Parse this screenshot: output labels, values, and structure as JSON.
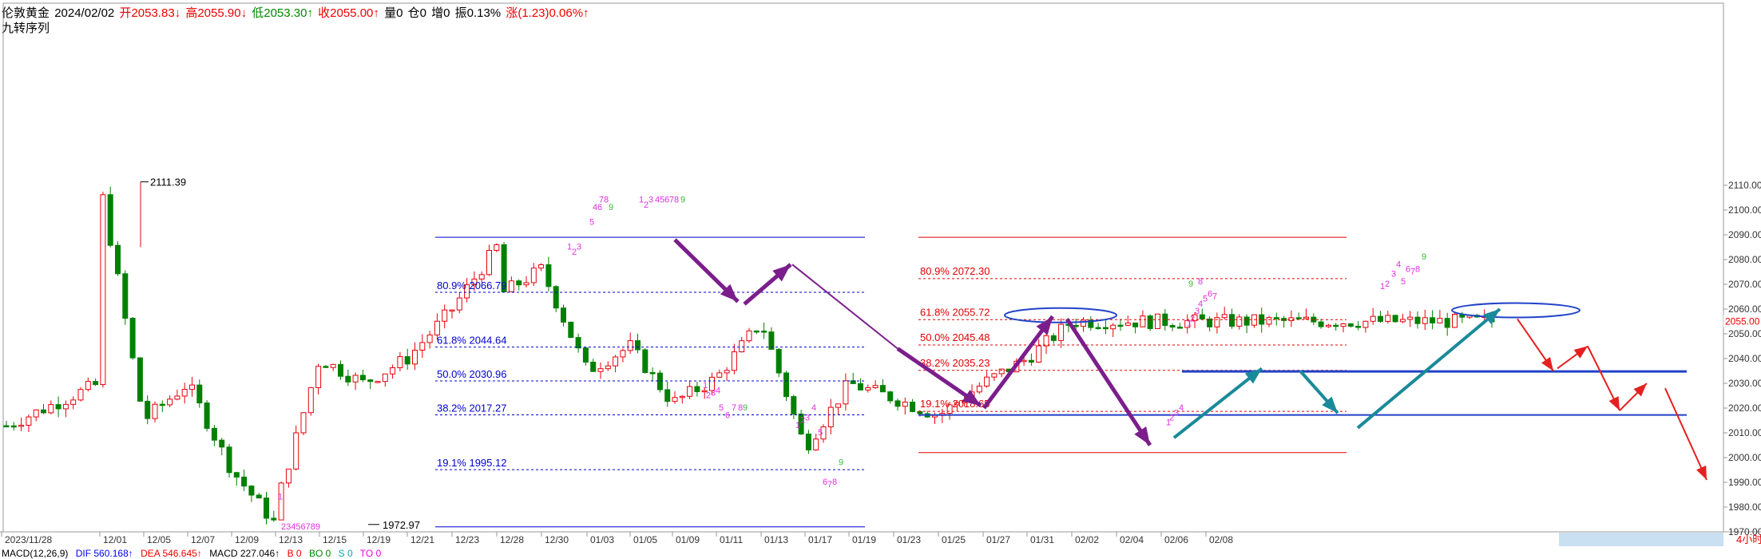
{
  "header": {
    "symbol": "伦敦黄金",
    "date": "2024/02/02",
    "open": "开2053.83↓",
    "high": "高2055.90↓",
    "low": "低2053.30↑",
    "close": "收2055.00↑",
    "volume": "量0",
    "position": "仓0",
    "increase": "增0",
    "amplitude": "振0.13%",
    "change": "涨(1.23)0.06%↑",
    "indicator": "九转序列"
  },
  "bottom_bar": {
    "macd": "MACD(12,26,9)",
    "dif": "DIF 560.168↑",
    "dea": "DEA 546.645↑",
    "macd_val": "MACD 227.046↑",
    "ao": "B 0",
    "bo": "BO 0",
    "s": "S 0",
    "to": "TO 0"
  },
  "colors": {
    "up": "#e8000b",
    "down": "#008000",
    "fib_left": "#0000cc",
    "fib_right": "#e00000",
    "purple_arrow": "#7b1e8c",
    "teal_arrow": "#1a8a9a",
    "red_arrow": "#e52020",
    "h_line": "#2142c8",
    "td_pink": "#e030e0",
    "td_green": "#30c030"
  },
  "chart_data": {
    "type": "candlestick",
    "title": "伦敦黄金 4小时",
    "timeframe": "4小时",
    "ylim": [
      1970,
      2120
    ],
    "yticks": [
      "1970.00",
      "1980.00",
      "1990.00",
      "2000.00",
      "2010.00",
      "2020.00",
      "2030.00",
      "2040.00",
      "2050.00",
      "2060.00",
      "2070.00",
      "2080.00",
      "2090.00",
      "2100.00",
      "2110.00"
    ],
    "xticks": [
      "2023/11/28",
      "12/01",
      "12/05",
      "12/07",
      "12/09",
      "12/13",
      "12/15",
      "12/19",
      "12/21",
      "12/23",
      "12/28",
      "12/30",
      "01/03",
      "01/05",
      "01/09",
      "01/11",
      "01/13",
      "01/17",
      "01/19",
      "01/23",
      "01/25",
      "01/27",
      "01/31",
      "02/02",
      "02/04",
      "02/06",
      "02/08"
    ],
    "last_price": "2055.00",
    "annotations": {
      "high_label": "2111.39",
      "low_label": "1972.97"
    },
    "fib_left": [
      {
        "label": "80.9% 2066.79",
        "value": 2066.79
      },
      {
        "label": "61.8% 2044.64",
        "value": 2044.64
      },
      {
        "label": "50.0% 2030.96",
        "value": 2030.96
      },
      {
        "label": "38.2% 2017.27",
        "value": 2017.27
      },
      {
        "label": "19.1% 1995.12",
        "value": 1995.12
      }
    ],
    "fib_left_bounds": [
      2089,
      1972
    ],
    "fib_right": [
      {
        "label": "80.9% 2072.30",
        "value": 2072.3
      },
      {
        "label": "61.8% 2055.72",
        "value": 2055.72
      },
      {
        "label": "50.0% 2045.48",
        "value": 2045.48
      },
      {
        "label": "38.2% 2035.23",
        "value": 2035.23
      },
      {
        "label": "19.1% 2018.65",
        "value": 2018.65
      }
    ],
    "fib_right_bounds": [
      2089,
      2002
    ],
    "support_lines": [
      2034.8,
      2017.2
    ],
    "anchors": [
      {
        "date": "2023/11/28",
        "price": 2012
      },
      {
        "date": "12/01",
        "price": 2030
      },
      {
        "date": "12/01",
        "price": 2111.39
      },
      {
        "date": "12/05",
        "price": 2015
      },
      {
        "date": "12/07",
        "price": 2030
      },
      {
        "date": "12/09",
        "price": 1995
      },
      {
        "date": "12/13",
        "price": 1972.97
      },
      {
        "date": "12/13",
        "price": 1980
      },
      {
        "date": "12/15",
        "price": 2040
      },
      {
        "date": "12/19",
        "price": 2030
      },
      {
        "date": "12/21",
        "price": 2040
      },
      {
        "date": "12/23",
        "price": 2060
      },
      {
        "date": "12/28",
        "price": 2085
      },
      {
        "date": "12/28",
        "price": 2065
      },
      {
        "date": "12/30",
        "price": 2076
      },
      {
        "date": "01/03",
        "price": 2035
      },
      {
        "date": "01/05",
        "price": 2045
      },
      {
        "date": "01/09",
        "price": 2022
      },
      {
        "date": "01/11",
        "price": 2032
      },
      {
        "date": "01/13",
        "price": 2055
      },
      {
        "date": "01/17",
        "price": 2004
      },
      {
        "date": "01/19",
        "price": 2030
      },
      {
        "date": "01/23",
        "price": 2024
      },
      {
        "date": "01/25",
        "price": 2017
      },
      {
        "date": "01/27",
        "price": 2030
      },
      {
        "date": "01/31",
        "price": 2040
      },
      {
        "date": "02/02",
        "price": 2055
      }
    ]
  }
}
